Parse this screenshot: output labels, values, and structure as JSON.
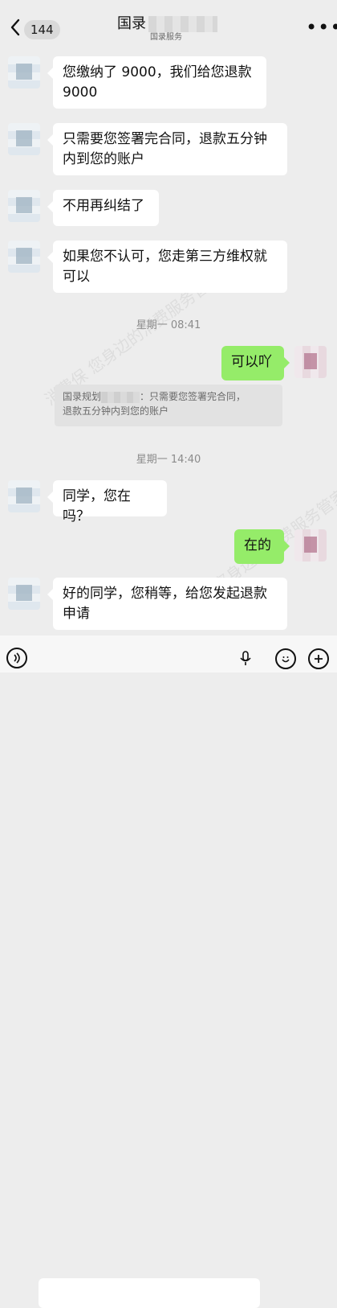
{
  "header": {
    "back_count": "144",
    "title_visible": "国录",
    "subtitle": "国录服务"
  },
  "messages": {
    "m1": [
      "您缴纳了 9000，我们给您退款",
      "9000"
    ],
    "m2": [
      "只需要您签署完合同，退款五分钟",
      "内到您的账户"
    ],
    "m3": "不用再纠结了",
    "m4": [
      "如果您不认可，您走第三方维权就",
      "可以"
    ],
    "time1": "星期一 08:41",
    "reply1": "可以吖",
    "quote": {
      "prefix": "国录规划",
      "suffix": "：只需要您签署完合同，",
      "line2": "退款五分钟内到您的账户"
    },
    "time2": "星期一 14:40",
    "m5": "同学，您在吗？",
    "reply2": "在的",
    "m6": [
      "好的同学，您稍等，给您发起退款",
      "申请"
    ]
  },
  "watermark": [
    "消费保 您身边的消费服务管家",
    "消费保 您身边的消费服务管家"
  ],
  "icons": [
    "back-icon",
    "more-icon",
    "voice-icon",
    "emoji-icon",
    "add-icon",
    "mic-icon"
  ]
}
